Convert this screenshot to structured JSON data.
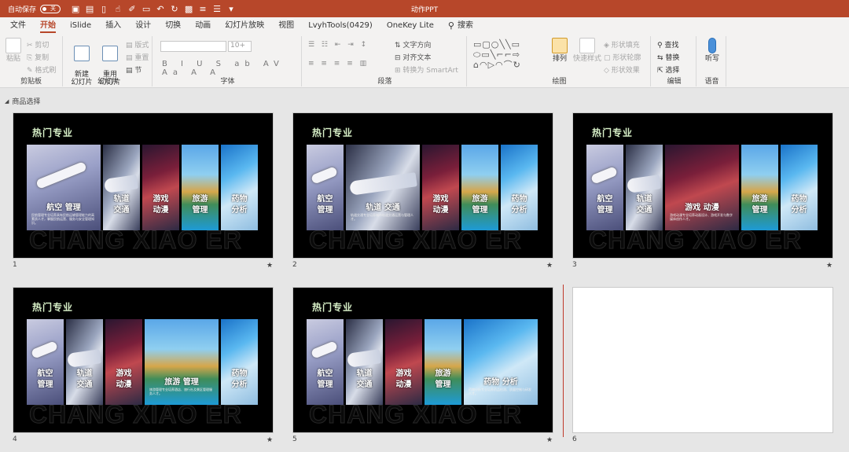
{
  "titlebar": {
    "autosave_label": "自动保存",
    "autosave_state": "关",
    "doc_title": "动作PPT",
    "qat_icons": [
      "save-icon",
      "save-as-icon",
      "new-file-icon",
      "touch-mode-icon",
      "format-painter-icon",
      "open-icon",
      "undo-icon",
      "redo-icon",
      "slideshow-icon",
      "align-icon",
      "distribute-icon",
      "more-icon"
    ]
  },
  "tabs": [
    {
      "label": "文件",
      "active": false
    },
    {
      "label": "开始",
      "active": true
    },
    {
      "label": "iSlide",
      "active": false
    },
    {
      "label": "插入",
      "active": false
    },
    {
      "label": "设计",
      "active": false
    },
    {
      "label": "切换",
      "active": false
    },
    {
      "label": "动画",
      "active": false
    },
    {
      "label": "幻灯片放映",
      "active": false
    },
    {
      "label": "视图",
      "active": false
    },
    {
      "label": "LvyhTools(0429)",
      "active": false
    },
    {
      "label": "OneKey Lite",
      "active": false
    }
  ],
  "search_label": "搜索",
  "ribbon": {
    "clipboard": {
      "label": "剪贴板",
      "paste": "粘贴",
      "cut": "剪切",
      "copy": "复制",
      "format_painter": "格式刷"
    },
    "slides": {
      "label": "幻灯片",
      "new_slide": "新建\n幻灯片",
      "reuse": "重用\n幻灯片",
      "layout": "版式",
      "reset": "重置",
      "section": "节"
    },
    "font": {
      "label": "字体",
      "size": "10+",
      "format_buttons": "B I U S ab AV Aa A A"
    },
    "paragraph": {
      "label": "段落",
      "text_direction": "文字方向",
      "align_text": "对齐文本",
      "smartart": "转换为 SmartArt"
    },
    "drawing": {
      "label": "绘图",
      "arrange": "排列",
      "quick_styles": "快速样式",
      "shape_fill": "形状填充",
      "shape_outline": "形状轮廓",
      "shape_effects": "形状效果"
    },
    "editing": {
      "label": "编辑",
      "find": "查找",
      "replace": "替换",
      "select": "选择"
    },
    "voice": {
      "label": "语音",
      "dictate": "听写"
    }
  },
  "section_name": "商品选择",
  "slide_title": "热门专业",
  "watermark": "CHANG XIAO ER",
  "panels": {
    "aviation": {
      "caption": "航空\n管理",
      "desc": "民航管理专业培养具有民航运输管理能力的高素质人才，掌握民航运营、服务与安全管理知识。"
    },
    "rail": {
      "caption": "轨道\n交通",
      "desc": "轨道交通专业培养城市轨道交通运营与管理人才。"
    },
    "game": {
      "caption": "游戏\n动漫",
      "desc": "游戏动漫专业培养动画设计、游戏开发与数字媒体创作人才。"
    },
    "tour": {
      "caption": "旅游\n管理",
      "desc": "旅游管理专业培养酒店、旅行社及景区管理服务人才。"
    },
    "pharma": {
      "caption": "药物\n分析",
      "desc": "药物分析专业培养药品检测、质量控制与研发人才。"
    }
  },
  "slides": [
    {
      "number": "1",
      "expanded": "aviation"
    },
    {
      "number": "2",
      "expanded": "rail"
    },
    {
      "number": "3",
      "expanded": "game"
    },
    {
      "number": "4",
      "expanded": "tour"
    },
    {
      "number": "5",
      "expanded": "pharma"
    },
    {
      "number": "6",
      "expanded": ""
    }
  ],
  "slide_marker": "★"
}
